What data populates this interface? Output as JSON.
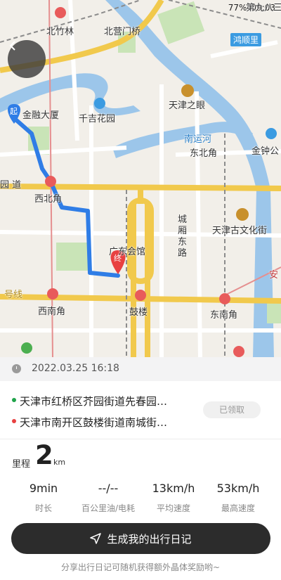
{
  "status_bar": {
    "battery": "77%",
    "time": "09:03"
  },
  "map": {
    "labels": {
      "beizhulin": "北竹林",
      "beiyingmenqiao": "北营门桥",
      "hongshunli": "鸿顺里",
      "diliba": "第九八三",
      "jinrongdasha": "金融大厦",
      "qianjihuayuan": "千吉花园",
      "tianjinzhiyan": "天津之眼",
      "nanyunhe": "南运河",
      "dongbeijiao": "东北角",
      "jinzhongqiao": "金钟公",
      "daodao": "园 道",
      "xibeijiao": "西北角",
      "tianjinguwenhuajie": "天津古文化街",
      "chengxiangdonglu": "城\n厢\n东\n路",
      "guangdonghuiguan": "广东会馆",
      "haoxian": "号线",
      "xinanjiao": "西南角",
      "gulou": "鼓楼",
      "dongnanjiao": "东南角",
      "an": "安",
      "start_marker": "起",
      "end_marker": "终"
    }
  },
  "trip": {
    "datetime": "2022.03.25 16:18",
    "start_address": "天津市红桥区芥园街道先春园…",
    "end_address": "天津市南开区鼓楼街道南城街…",
    "claimed_label": "已领取"
  },
  "distance": {
    "label": "里程",
    "value": "2",
    "unit": "km"
  },
  "stats": [
    {
      "value": "9min",
      "label": "时长"
    },
    {
      "value": "--/--",
      "label": "百公里油/电耗"
    },
    {
      "value": "13km/h",
      "label": "平均速度"
    },
    {
      "value": "53km/h",
      "label": "最高速度"
    }
  ],
  "cta": {
    "label": "生成我的出行日记"
  },
  "hint": "分享出行日记可随机获得额外晶体奖励哟~",
  "colors": {
    "route": "#2f7de6",
    "start_dot": "#1fa34a",
    "end_dot": "#e84040",
    "cta_bg": "#2c2c2c"
  }
}
